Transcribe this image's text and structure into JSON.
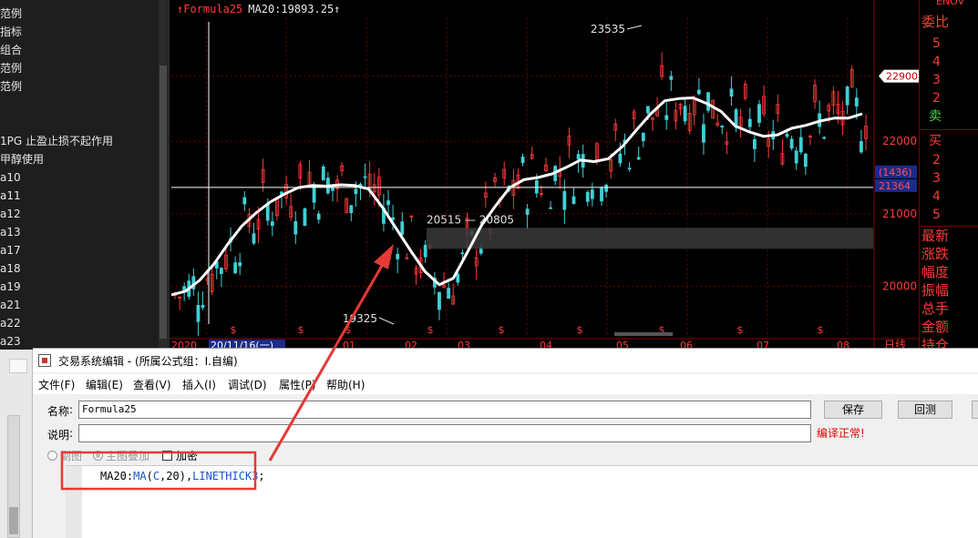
{
  "left_list": {
    "items": [
      "范例",
      "指标",
      "组合",
      "范例",
      "范例",
      "",
      "",
      "1PG 止盈止损不起作用",
      "甲醇使用",
      "a10",
      "a11",
      "a12",
      "a13",
      "a17",
      "a18",
      "a19",
      "a21",
      "a22",
      "a23"
    ]
  },
  "chart": {
    "legend_formula": "Formula25",
    "legend_ma": "MA20:19893.25",
    "price_axis": [
      "22000",
      "21000",
      "20000"
    ],
    "current_price_tag": "22900",
    "crosshair_tag_top": "(1436)",
    "crosshair_tag_bottom": "21364",
    "high_label": "23535",
    "low_label": "19325",
    "range_label": "20515 — 20805",
    "time_axis": [
      "2020",
      "20/11/16(一)",
      "01",
      "02",
      "03",
      "04",
      "05",
      "06",
      "07",
      "08"
    ],
    "time_axis_right": "日线",
    "dividend_marker": "$",
    "colors": {
      "up": "#ff3a3a",
      "down": "#3fd0d6",
      "ma": "#ffffff",
      "grid": "#6b0000"
    }
  },
  "chart_data": {
    "type": "line",
    "series": [
      {
        "name": "MA20",
        "values": [
          19880,
          19930,
          20080,
          20300,
          20580,
          20830,
          21010,
          21160,
          21270,
          21360,
          21390,
          21380,
          21400,
          21390,
          21340,
          21080,
          20780,
          20480,
          20200,
          20020,
          20110,
          20470,
          20840,
          21110,
          21360,
          21470,
          21500,
          21550,
          21640,
          21740,
          21720,
          21760,
          21930,
          22160,
          22380,
          22560,
          22590,
          22600,
          22520,
          22410,
          22210,
          22130,
          22070,
          22090,
          22180,
          22220,
          22280,
          22320,
          22320,
          22380
        ]
      }
    ],
    "ylim": [
      19300,
      23700
    ],
    "annotations": {
      "high": 23535,
      "low": 19325,
      "zone": [
        20515,
        20805
      ],
      "crosshair_price": 21364
    }
  },
  "right_panel": {
    "title": "委比",
    "sell_label": "卖",
    "buy_label": "买",
    "sell_levels": [
      "5",
      "4",
      "3",
      "2"
    ],
    "buy_levels": [
      "2",
      "3",
      "4",
      "5"
    ],
    "info_rows": [
      "最新",
      "涨跌",
      "幅度",
      "振幅",
      "总手",
      "金额",
      "持仓"
    ],
    "top_text": "ENOV"
  },
  "editor": {
    "title": "交易系统编辑 - (所属公式组：I.自编)",
    "menu": [
      "文件(F)",
      "编辑(E)",
      "查看(V)",
      "插入(I)",
      "调试(D)",
      "属性(P)",
      "帮助(H)"
    ],
    "name_label": "名称",
    "name_value": "Formula25",
    "desc_label": "说明",
    "desc_value": "",
    "save_button": "保存",
    "test_button": "回测",
    "compile_status": "编译正常!",
    "opt_sub_chart": "副图",
    "opt_main_overlay": "主图叠加",
    "opt_encrypt": "加密",
    "code_prefix": "MA20:",
    "code_func": "MA",
    "code_args_open": "(",
    "code_arg1": "C",
    "code_args_rest": ",20),",
    "code_thick": "LINETHICK3",
    "code_end": ";",
    "annotation_color": "#e53935"
  }
}
